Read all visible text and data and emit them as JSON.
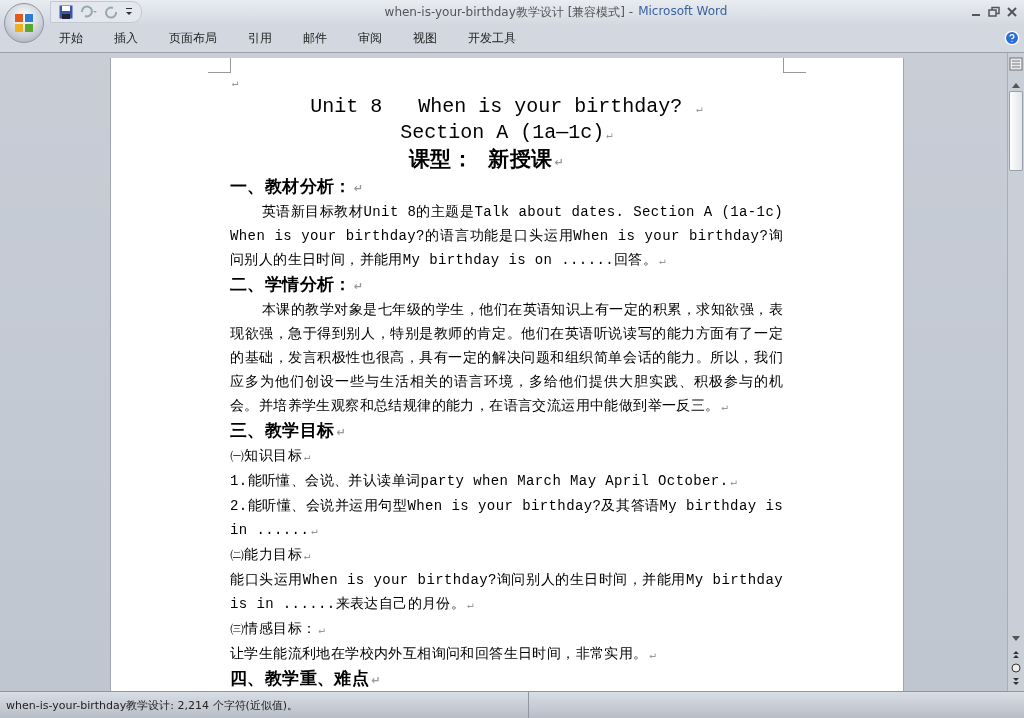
{
  "window": {
    "document_title": "when-is-your-birthday教学设计 [兼容模式] -",
    "app_name": "Microsoft Word"
  },
  "ribbon_tabs": [
    {
      "label": "开始",
      "selected": false
    },
    {
      "label": "插入",
      "selected": false
    },
    {
      "label": "页面布局",
      "selected": false
    },
    {
      "label": "引用",
      "selected": false
    },
    {
      "label": "邮件",
      "selected": false
    },
    {
      "label": "审阅",
      "selected": false
    },
    {
      "label": "视图",
      "selected": false
    },
    {
      "label": "开发工具",
      "selected": false
    }
  ],
  "document": {
    "paragraph_mark": "↵",
    "paragraphs": [
      {
        "kind": "empty"
      },
      {
        "kind": "title",
        "text": "Unit 8   When is your birthday? "
      },
      {
        "kind": "title",
        "text": "Section A (1a—1c)"
      },
      {
        "kind": "subtitle",
        "text": "课型：  新授课"
      },
      {
        "kind": "heading",
        "text": "一、教材分析："
      },
      {
        "kind": "body",
        "text": "英语新目标教材Unit 8的主题是Talk about dates. Section A (1a-1c) When is your birthday?的语言功能是口头运用When is your birthday?询问别人的生日时间，并能用My birthday is on ......回答。"
      },
      {
        "kind": "heading",
        "text": "二、学情分析："
      },
      {
        "kind": "body",
        "text": "本课的教学对象是七年级的学生，他们在英语知识上有一定的积累，求知欲强，表现欲强，急于得到别人，特别是教师的肯定。他们在英语听说读写的能力方面有了一定的基础，发言积极性也很高，具有一定的解决问题和组织简单会话的能力。所以，我们应多为他们创设一些与生活相关的语言环境，多给他们提供大胆实践、积极参与的机会。并培养学生观察和总结规律的能力，在语言交流运用中能做到举一反三。"
      },
      {
        "kind": "heading",
        "text": "三、教学目标"
      },
      {
        "kind": "plain",
        "text": "㈠知识目标"
      },
      {
        "kind": "plain",
        "text": "1.能听懂、会说、并认读单词party  when March May April October."
      },
      {
        "kind": "plain",
        "text": "2.能听懂、会说并运用句型When is your birthday?及其答语My birthday is in ......"
      },
      {
        "kind": "plain",
        "text": "㈡能力目标"
      },
      {
        "kind": "plain",
        "text": "能口头运用When is your birthday?询问别人的生日时间，并能用My birthday is in ......来表达自己的月份。"
      },
      {
        "kind": "plain",
        "text": "㈢情感目标："
      },
      {
        "kind": "plain",
        "text": "让学生能流利地在学校内外互相询问和回答生日时间，非常实用。"
      },
      {
        "kind": "heading",
        "text": "四、教学重、难点"
      }
    ]
  },
  "status_bar": {
    "text": "when-is-your-birthday教学设计: 2,214 个字符(近似值)。"
  }
}
